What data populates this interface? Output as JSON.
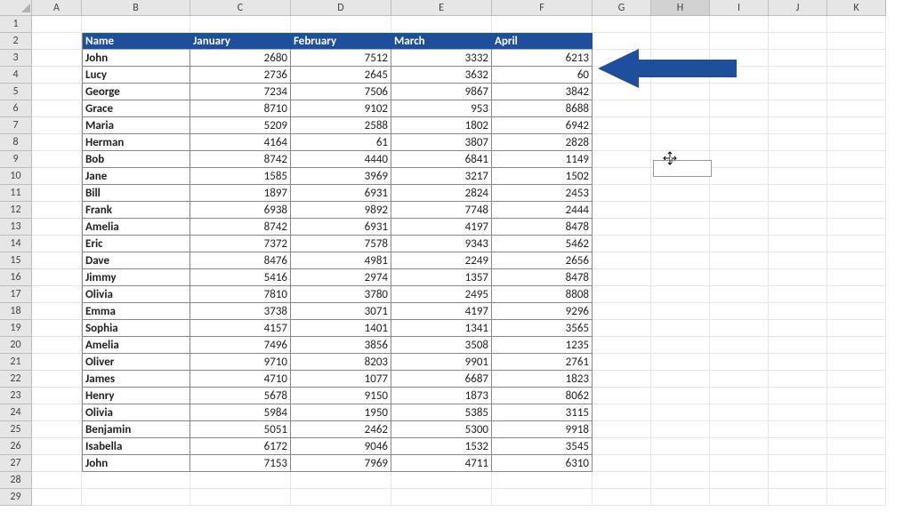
{
  "columns": [
    "A",
    "B",
    "C",
    "D",
    "E",
    "F",
    "G",
    "H",
    "I",
    "J",
    "K"
  ],
  "selected_column": "H",
  "row_count": 29,
  "table": {
    "headers": [
      "Name",
      "January",
      "February",
      "March",
      "April"
    ],
    "rows": [
      {
        "name": "John",
        "jan": 2680,
        "feb": 7512,
        "mar": 3332,
        "apr": 6213
      },
      {
        "name": "Lucy",
        "jan": 2736,
        "feb": 2645,
        "mar": 3632,
        "apr": 60
      },
      {
        "name": "George",
        "jan": 7234,
        "feb": 7506,
        "mar": 9867,
        "apr": 3842
      },
      {
        "name": "Grace",
        "jan": 8710,
        "feb": 9102,
        "mar": 953,
        "apr": 8688
      },
      {
        "name": "Maria",
        "jan": 5209,
        "feb": 2588,
        "mar": 1802,
        "apr": 6942
      },
      {
        "name": "Herman",
        "jan": 4164,
        "feb": 61,
        "mar": 3807,
        "apr": 2828
      },
      {
        "name": "Bob",
        "jan": 8742,
        "feb": 4440,
        "mar": 6841,
        "apr": 1149
      },
      {
        "name": "Jane",
        "jan": 1585,
        "feb": 3969,
        "mar": 3217,
        "apr": 1502
      },
      {
        "name": "Bill",
        "jan": 1897,
        "feb": 6931,
        "mar": 2824,
        "apr": 2453
      },
      {
        "name": "Frank",
        "jan": 6938,
        "feb": 9892,
        "mar": 7748,
        "apr": 2444
      },
      {
        "name": "Amelia",
        "jan": 8742,
        "feb": 6931,
        "mar": 4197,
        "apr": 8478
      },
      {
        "name": "Eric",
        "jan": 7372,
        "feb": 7578,
        "mar": 9343,
        "apr": 5462
      },
      {
        "name": "Dave",
        "jan": 8476,
        "feb": 4981,
        "mar": 2249,
        "apr": 2656
      },
      {
        "name": "Jimmy",
        "jan": 5416,
        "feb": 2974,
        "mar": 1357,
        "apr": 8478
      },
      {
        "name": "Olivia",
        "jan": 7810,
        "feb": 3780,
        "mar": 2495,
        "apr": 8808
      },
      {
        "name": "Emma",
        "jan": 3738,
        "feb": 3071,
        "mar": 4197,
        "apr": 9296
      },
      {
        "name": "Sophia",
        "jan": 4157,
        "feb": 1401,
        "mar": 1341,
        "apr": 3565
      },
      {
        "name": "Amelia",
        "jan": 7496,
        "feb": 3856,
        "mar": 3508,
        "apr": 1235
      },
      {
        "name": "Oliver",
        "jan": 9710,
        "feb": 8203,
        "mar": 9901,
        "apr": 2761
      },
      {
        "name": "James",
        "jan": 4710,
        "feb": 1077,
        "mar": 6687,
        "apr": 1823
      },
      {
        "name": "Henry",
        "jan": 5678,
        "feb": 9150,
        "mar": 1873,
        "apr": 8062
      },
      {
        "name": "Olivia",
        "jan": 5984,
        "feb": 1950,
        "mar": 5385,
        "apr": 3115
      },
      {
        "name": "Benjamin",
        "jan": 5051,
        "feb": 2462,
        "mar": 5300,
        "apr": 9918
      },
      {
        "name": "Isabella",
        "jan": 6172,
        "feb": 9046,
        "mar": 1532,
        "apr": 3545
      },
      {
        "name": "John",
        "jan": 7153,
        "feb": 7969,
        "mar": 4711,
        "apr": 6310
      }
    ]
  },
  "arrow_color": "#1f4e9c",
  "select_box_cell": "H9"
}
